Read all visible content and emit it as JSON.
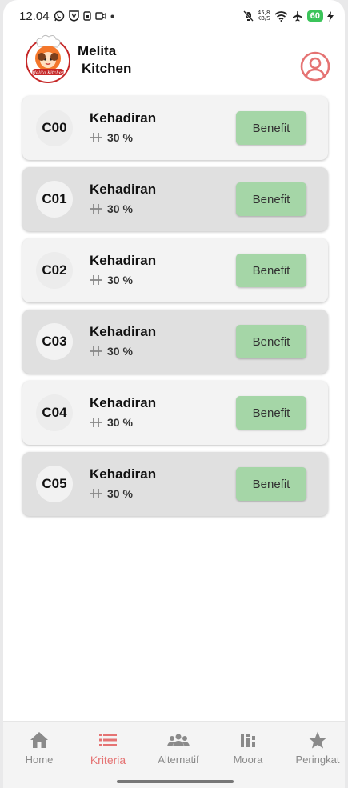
{
  "status_bar": {
    "time": "12.04",
    "net_speed": "45,8",
    "net_unit": "KB/S",
    "battery": "60"
  },
  "header": {
    "brand_line1": "Melita",
    "brand_line2": "Kitchen",
    "logo_text": "Melita Kitchen",
    "icons": [
      "chef-logo",
      "account-circle-icon"
    ]
  },
  "criteria": [
    {
      "code": "C00",
      "name": "Kehadiran",
      "weight": "30 %",
      "type": "Benefit",
      "shade": "light"
    },
    {
      "code": "C01",
      "name": "Kehadiran",
      "weight": "30 %",
      "type": "Benefit",
      "shade": "dark"
    },
    {
      "code": "C02",
      "name": "Kehadiran",
      "weight": "30 %",
      "type": "Benefit",
      "shade": "light"
    },
    {
      "code": "C03",
      "name": "Kehadiran",
      "weight": "30 %",
      "type": "Benefit",
      "shade": "dark"
    },
    {
      "code": "C04",
      "name": "Kehadiran",
      "weight": "30 %",
      "type": "Benefit",
      "shade": "light"
    },
    {
      "code": "C05",
      "name": "Kehadiran",
      "weight": "30 %",
      "type": "Benefit",
      "shade": "dark"
    }
  ],
  "nav": [
    {
      "label": "Home",
      "icon": "home-icon",
      "active": false
    },
    {
      "label": "Kriteria",
      "icon": "list-icon",
      "active": true
    },
    {
      "label": "Alternatif",
      "icon": "people-icon",
      "active": false
    },
    {
      "label": "Moora",
      "icon": "bar-chart-icon",
      "active": false
    },
    {
      "label": "Peringkat",
      "icon": "star-icon",
      "active": false
    }
  ],
  "colors": {
    "accent": "#e57373",
    "benefit_button": "#a5d6a7",
    "card_light": "#f3f3f3",
    "card_dark": "#e0e0e0",
    "nav_inactive": "#8a8a8a"
  }
}
